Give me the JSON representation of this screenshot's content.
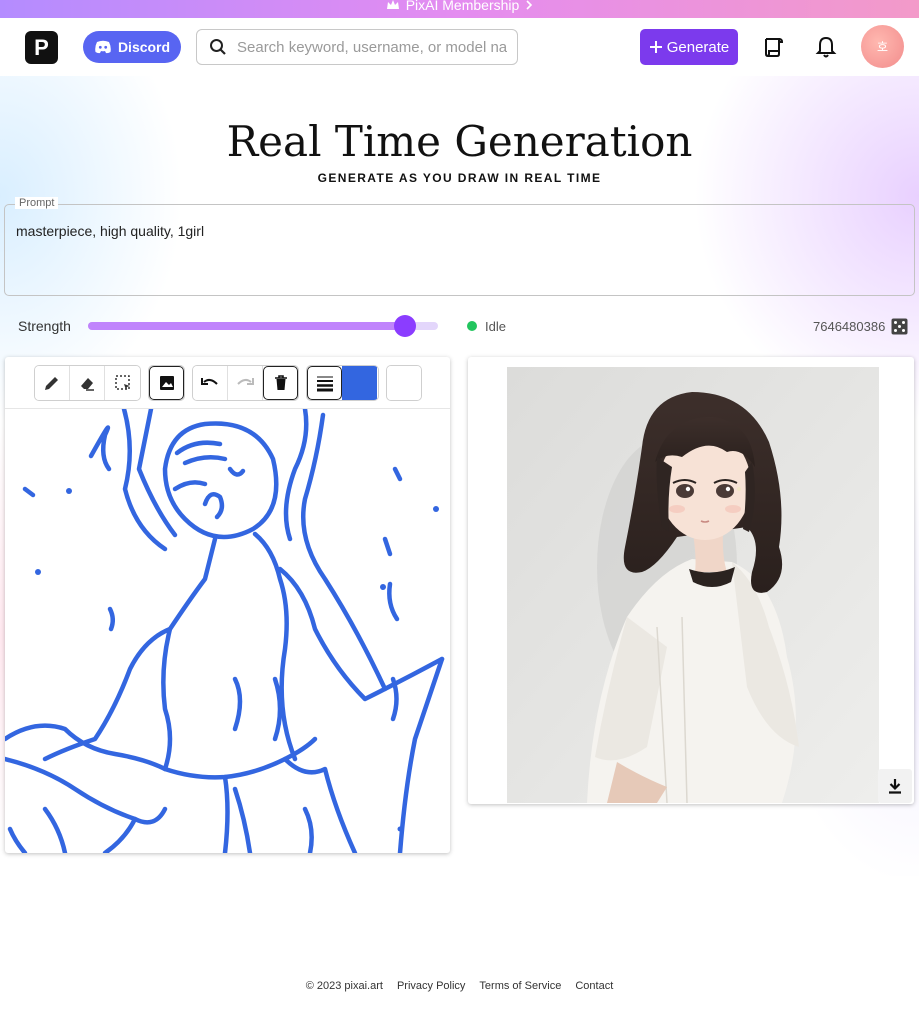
{
  "promo": {
    "label": "PixAI Membership"
  },
  "header": {
    "logo_letter": "P",
    "discord_label": "Discord",
    "search_placeholder": "Search keyword, username, or model name",
    "generate_label": "Generate",
    "avatar_text": "호"
  },
  "page": {
    "title": "Real Time Generation",
    "subtitle": "GENERATE AS YOU DRAW IN REAL TIME"
  },
  "prompt": {
    "label": "Prompt",
    "value": "masterpiece, high quality, 1girl"
  },
  "controls": {
    "strength_label": "Strength",
    "strength_value": 0.905,
    "status": "Idle",
    "status_color": "#22c55e",
    "seed": "7646480386"
  },
  "toolbar": {
    "brush_color": "#3366e0",
    "icons": [
      "pencil-icon",
      "eraser-icon",
      "select-icon",
      "image-icon",
      "undo-icon",
      "redo-icon",
      "trash-icon",
      "stroke-width-icon"
    ]
  },
  "colors": {
    "accent": "#7c3aed",
    "discord": "#5865f2",
    "sketch": "#3366e0"
  },
  "footer": {
    "copyright": "© 2023 pixai.art",
    "links": [
      "Privacy Policy",
      "Terms of Service",
      "Contact"
    ]
  }
}
